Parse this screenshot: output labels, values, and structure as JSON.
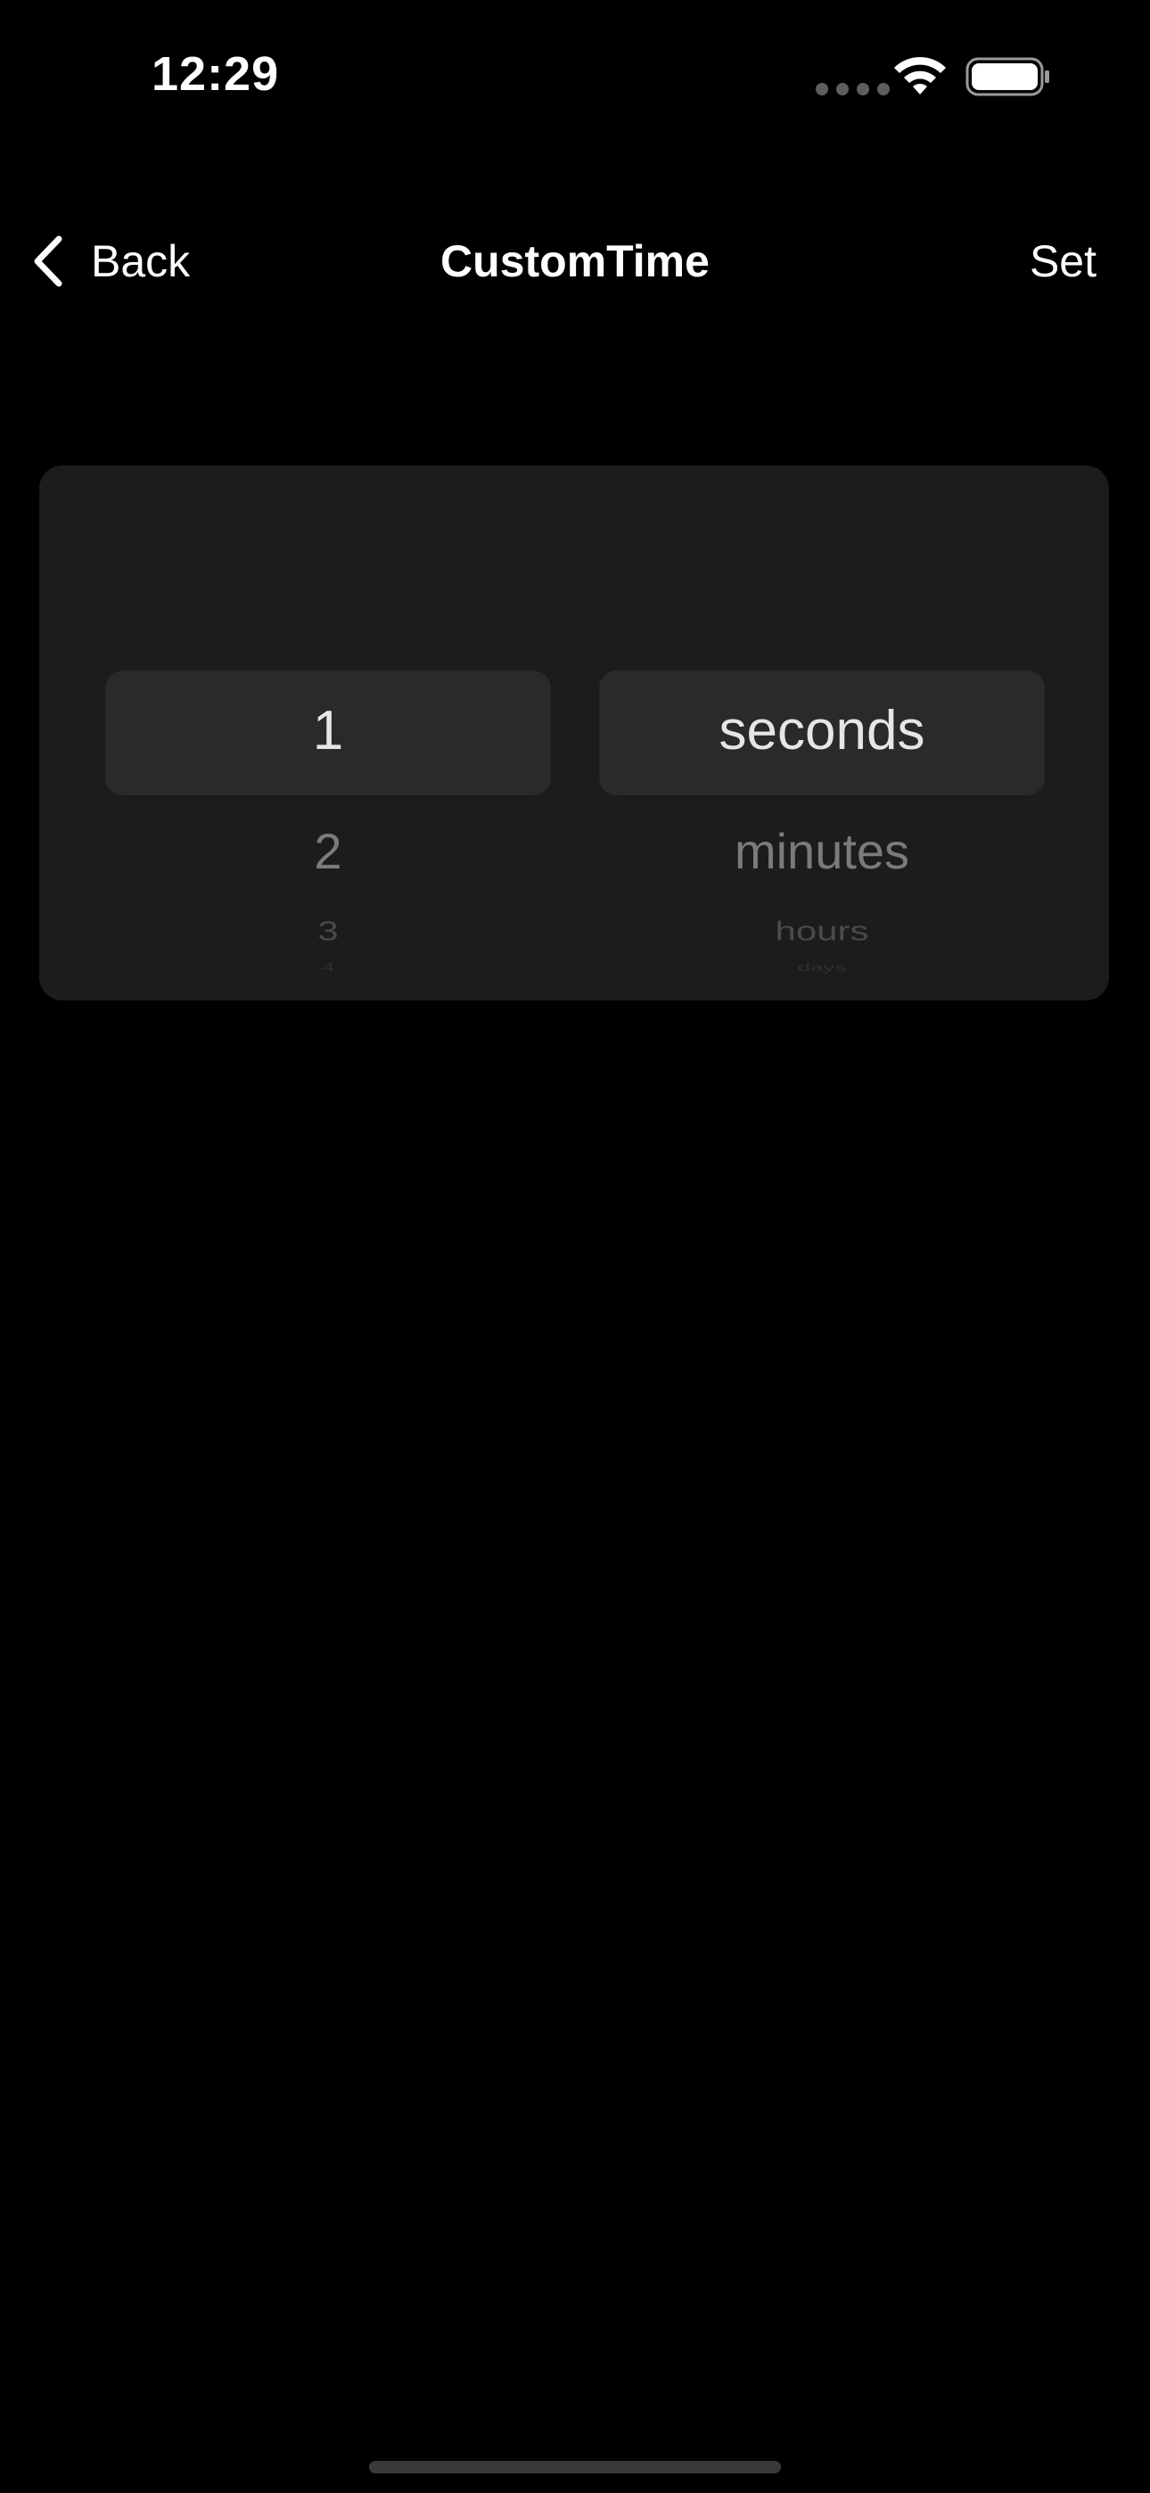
{
  "status_bar": {
    "time": "12:29",
    "icons": [
      "cellular-signal-icon",
      "wifi-icon",
      "battery-icon"
    ]
  },
  "nav": {
    "back_label": "Back",
    "title": "CustomTime",
    "set_label": "Set"
  },
  "picker": {
    "number_column": {
      "selected": "1",
      "items": [
        "1",
        "2",
        "3",
        "4"
      ]
    },
    "unit_column": {
      "selected": "seconds",
      "items": [
        "seconds",
        "minutes",
        "hours",
        "days"
      ]
    }
  },
  "colors": {
    "background": "#000000",
    "card": "#1c1c1e",
    "selection": "#2a2a2c",
    "text_primary": "#ffffff"
  }
}
